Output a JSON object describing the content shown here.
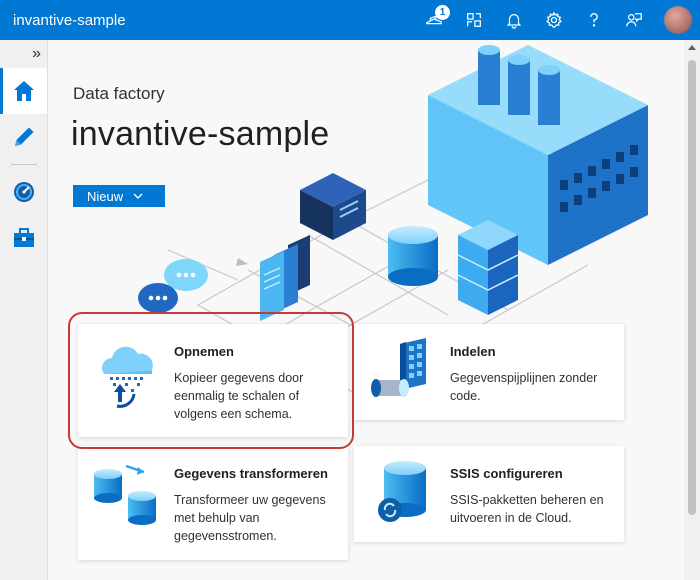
{
  "app": {
    "title": "invantive-sample"
  },
  "topbar": {
    "notification_count": "1",
    "icons": [
      "notifications-icon",
      "switch-directory-icon",
      "bell-icon",
      "gear-icon",
      "help-icon",
      "feedback-icon"
    ]
  },
  "nav": {
    "expand_glyph": "»"
  },
  "page": {
    "subtitle": "Data factory",
    "title": "invantive-sample",
    "new_button": "Nieuw"
  },
  "cards": {
    "ingest": {
      "title": "Opnemen",
      "desc": "Kopieer gegevens door eenmalig te schalen of volgens een schema."
    },
    "orchestrate": {
      "title": "Indelen",
      "desc": "Gegevenspijplijnen zonder code."
    },
    "transform": {
      "title": "Gegevens transformeren",
      "desc": "Transformeer uw gegevens met behulp van gegevensstromen."
    },
    "ssis": {
      "title": "SSIS configureren",
      "desc": "SSIS-pakketten beheren en uitvoeren in de Cloud."
    }
  },
  "colors": {
    "accent": "#0078d4",
    "highlight": "#c23a3a"
  }
}
